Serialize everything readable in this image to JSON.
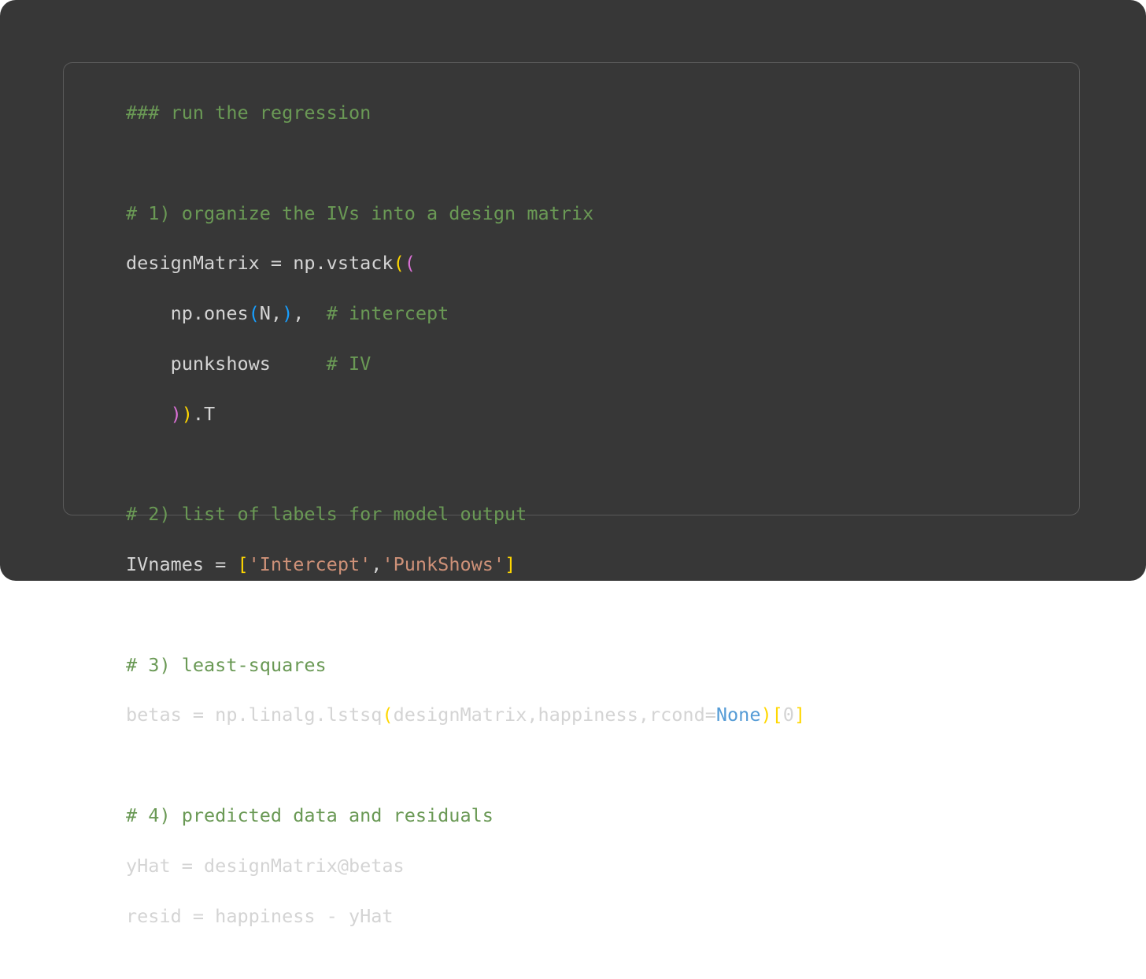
{
  "colors": {
    "background": "#373737",
    "panel_border": "#5a5a5a",
    "comment": "#6a9955",
    "text": "#d4d4d4",
    "string": "#ce9178",
    "keyword": "#569cd6",
    "bracket_level1": "#ffd700",
    "bracket_level2": "#da70d6",
    "bracket_level3": "#179fff"
  },
  "code": {
    "l1": {
      "c": "### run the regression"
    },
    "l3": {
      "c": "# 1) organize the IVs into a design matrix"
    },
    "l4": {
      "t1": "designMatrix = np.vstack",
      "p1": "(",
      "p2": "("
    },
    "l5": {
      "t1": "    np.ones",
      "p1": "(",
      "t2": "N,",
      "p2": ")",
      "t3": ",  ",
      "c": "# intercept"
    },
    "l6": {
      "t1": "    punkshows     ",
      "c": "# IV"
    },
    "l7": {
      "t1": "    ",
      "p1": ")",
      "p2": ")",
      "t2": ".T"
    },
    "l9": {
      "c": "# 2) list of labels for model output"
    },
    "l10": {
      "t1": "IVnames = ",
      "p1": "[",
      "s1": "'Intercept'",
      "t2": ",",
      "s2": "'PunkShows'",
      "p2": "]"
    },
    "l12": {
      "c": "# 3) least-squares"
    },
    "l13": {
      "t1": "betas = np.linalg.lstsq",
      "p1": "(",
      "t2": "designMatrix,happiness,rcond=",
      "k1": "None",
      "p2": ")",
      "p3": "[",
      "t3": "0",
      "p4": "]"
    },
    "l15": {
      "c": "# 4) predicted data and residuals"
    },
    "l16": {
      "t1": "yHat = designMatrix@betas"
    },
    "l17": {
      "t1": "resid = happiness - yHat"
    }
  }
}
